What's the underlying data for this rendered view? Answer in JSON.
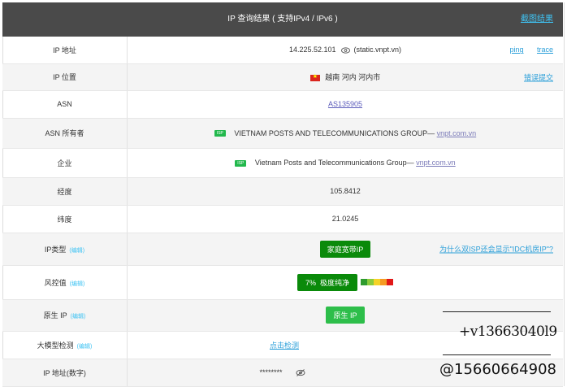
{
  "header": {
    "title": "IP 查询结果 ( 支持IPv4 / IPv6 )",
    "screenshot_link": "截图结果"
  },
  "rows": {
    "ip": {
      "label": "IP 地址",
      "value": "14.225.52.101",
      "host": "(static.vnpt.vn)",
      "ping": "ping",
      "trace": "trace"
    },
    "location": {
      "label": "IP 位置",
      "value": "越南 河内 河内市",
      "report": "错误提交"
    },
    "asn": {
      "label": "ASN",
      "value": "AS135905"
    },
    "asn_owner": {
      "label": "ASN 所有者",
      "tag": "ISP",
      "value": "VIETNAM POSTS AND TELECOMMUNICATIONS GROUP—",
      "domain": "vnpt.com.vn"
    },
    "company": {
      "label": "企业",
      "tag": "ISP",
      "value": "Vietnam Posts and Telecommunications Group—",
      "domain": "vnpt.com.vn"
    },
    "longitude": {
      "label": "经度",
      "value": "105.8412"
    },
    "latitude": {
      "label": "纬度",
      "value": "21.0245"
    },
    "ip_type": {
      "label": "IP类型",
      "edit": "(编辑)",
      "value": "家庭宽带IP",
      "question": "为什么双ISP还会显示\"IDC机房IP\"?"
    },
    "risk": {
      "label": "风控值",
      "edit": "(编辑)",
      "percent": "7%",
      "text": "极度纯净"
    },
    "native": {
      "label": "原生 IP",
      "edit": "(编辑)",
      "value": "原生 IP"
    },
    "model_detect": {
      "label": "大模型检测",
      "edit": "(编辑)",
      "value": "点击检测"
    },
    "ip_numeric": {
      "label": "IP 地址(数字)",
      "value": "********"
    }
  },
  "overlay": {
    "line1": "+v13663040l9",
    "line2": "@15660664908"
  },
  "colors": {
    "header_bg": "#4a4a4a",
    "accent_link": "#2b9fd9",
    "badge_green": "#0a8a0a",
    "badge_bright_green": "#2dbe4a"
  }
}
